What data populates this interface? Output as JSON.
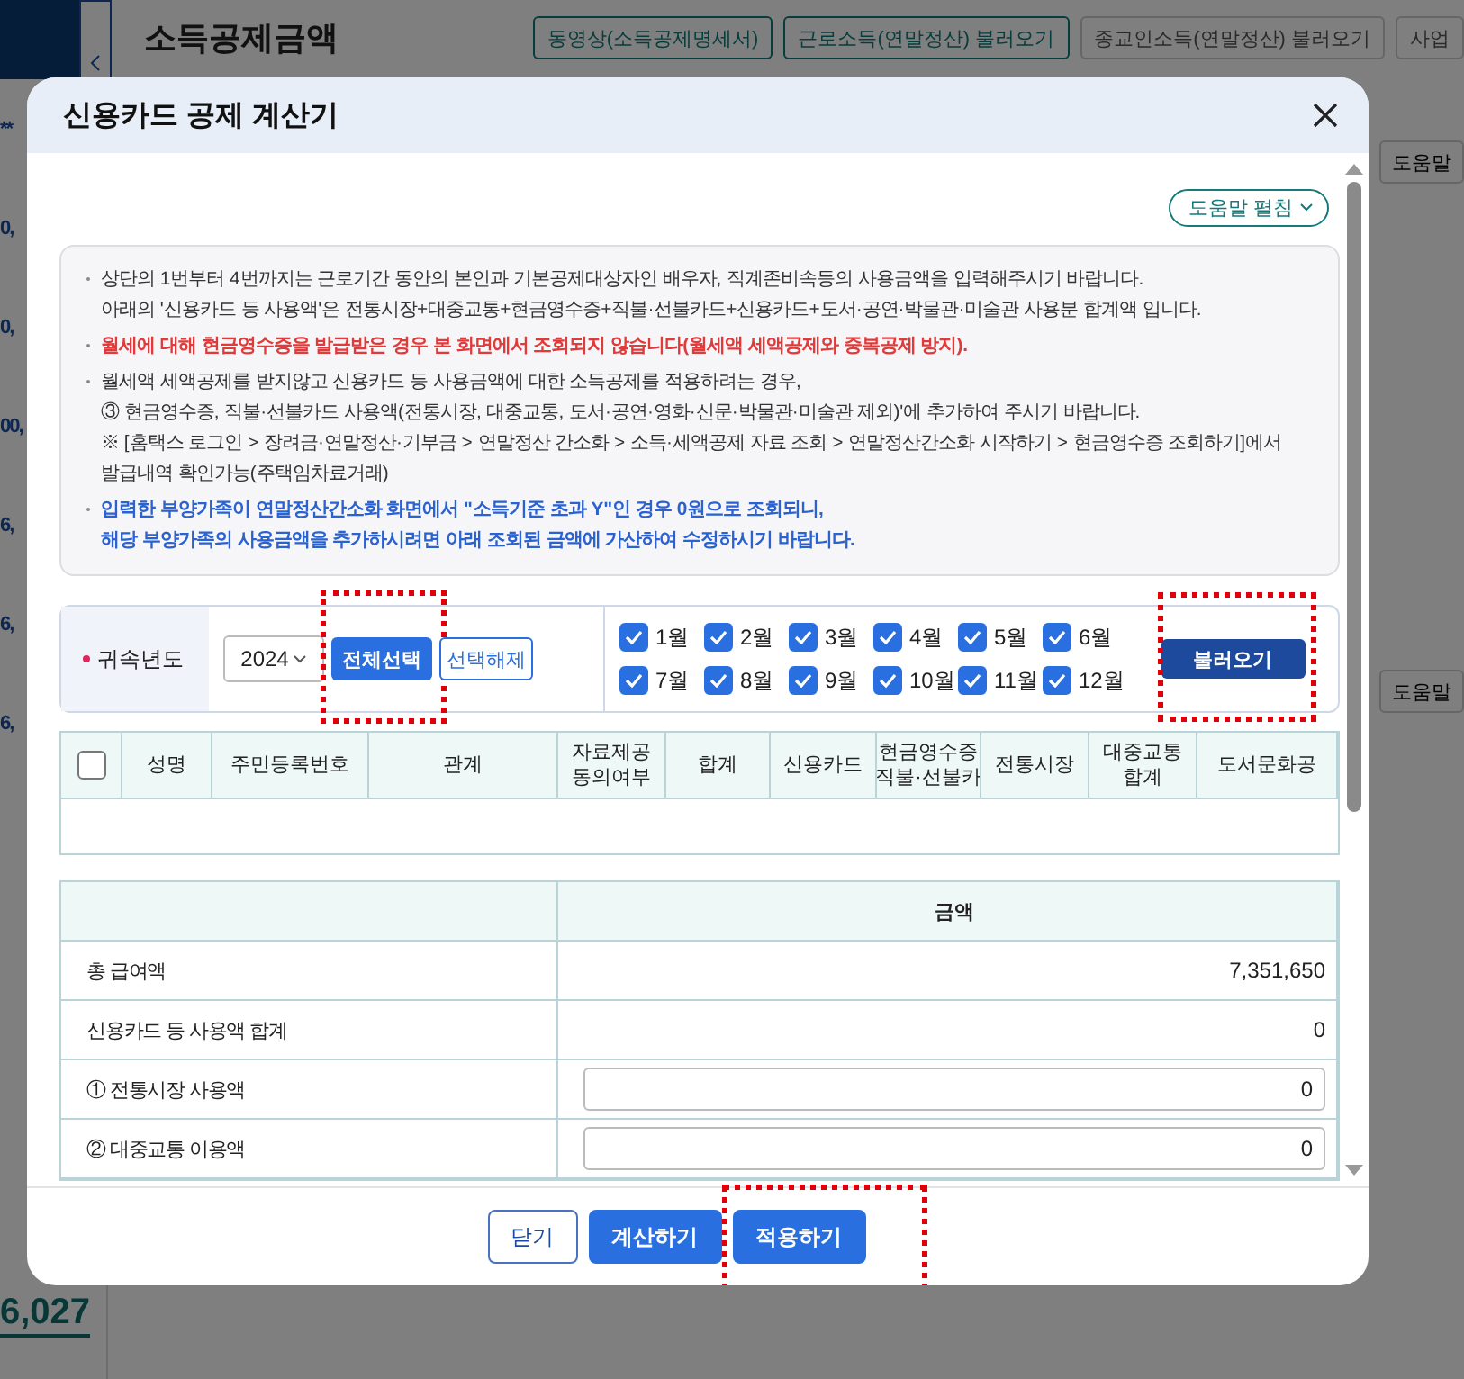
{
  "background": {
    "title": "소득공제금액",
    "buttons": [
      {
        "label": "동영상(소득공제명세서)",
        "kind": "outline"
      },
      {
        "label": "근로소득(연말정산) 불러오기",
        "kind": "outline"
      },
      {
        "label": "종교인소득(연말정산) 불러오기",
        "kind": "plain"
      },
      {
        "label": "사업",
        "kind": "plain"
      }
    ],
    "side_texts": [
      "**",
      "0,",
      "0,",
      "00,",
      "6,",
      "6,",
      "6,"
    ],
    "side_total": "6,027",
    "help_buttons": [
      "도움말",
      "도움말"
    ]
  },
  "modal": {
    "title": "신용카드 공제 계산기",
    "help_toggle": "도움말 펼침",
    "notices": [
      {
        "kind": "default",
        "lines": [
          "상단의 1번부터 4번까지는 근로기간 동안의 본인과 기본공제대상자인 배우자, 직계존비속등의 사용금액을 입력해주시기 바랍니다.",
          "아래의 '신용카드 등 사용액'은 전통시장+대중교통+현금영수증+직불·선불카드+신용카드+도서·공연·박물관·미술관 사용분 합계액 입니다."
        ]
      },
      {
        "kind": "alert",
        "lines": [
          "월세에 대해 현금영수증을 발급받은 경우 본 화면에서 조회되지 않습니다(월세액 세액공제와 중복공제 방지)."
        ]
      },
      {
        "kind": "default",
        "lines": [
          "월세액 세액공제를 받지않고 신용카드 등 사용금액에 대한 소득공제를 적용하려는 경우,",
          "③ 현금영수증, 직불·선불카드 사용액(전통시장, 대중교통, 도서·공연·영화·신문·박물관·미술관 제외)'에 추가하여 주시기 바랍니다.",
          "※ [홈택스 로그인 > 장려금·연말정산·기부금 > 연말정산 간소화 > 소득·세액공제 자료 조회 > 연말정산간소화 시작하기 > 현금영수증 조회하기]에서",
          "발급내역 확인가능(주택임차료거래)"
        ]
      },
      {
        "kind": "info",
        "lines": [
          "입력한 부양가족이 연말정산간소화 화면에서 \"소득기준 초과 Y\"인 경우 0원으로 조회되니,",
          "해당 부양가족의 사용금액을 추가하시려면 아래 조회된 금액에 가산하여 수정하시기 바랍니다."
        ]
      }
    ],
    "year": {
      "label": "귀속년도",
      "value": "2024"
    },
    "select_all": {
      "label": "전체선택",
      "highlighted": true
    },
    "deselect_all": {
      "label": "선택해제",
      "highlighted": false
    },
    "months": [
      {
        "label": "1월",
        "checked": true
      },
      {
        "label": "2월",
        "checked": true
      },
      {
        "label": "3월",
        "checked": true
      },
      {
        "label": "4월",
        "checked": true
      },
      {
        "label": "5월",
        "checked": true
      },
      {
        "label": "6월",
        "checked": true
      },
      {
        "label": "7월",
        "checked": true
      },
      {
        "label": "8월",
        "checked": true
      },
      {
        "label": "9월",
        "checked": true
      },
      {
        "label": "10월",
        "checked": true
      },
      {
        "label": "11월",
        "checked": true
      },
      {
        "label": "12월",
        "checked": true
      }
    ],
    "load": {
      "label": "불러오기",
      "highlighted": true
    },
    "family_table": {
      "select_all_checked": false,
      "columns": [
        [
          "성명"
        ],
        [
          "주민등록번호"
        ],
        [
          "관계"
        ],
        [
          "자료제공",
          "동의여부"
        ],
        [
          "합계"
        ],
        [
          "신용카드"
        ],
        [
          "현금영수증",
          "직불·선불카"
        ],
        [
          "전통시장"
        ],
        [
          "대중교통",
          "합계"
        ],
        [
          "도서문화공"
        ]
      ]
    },
    "amount_table": {
      "header": "금액",
      "rows": [
        {
          "label": "총 급여액",
          "kind": "text",
          "value": "7,351,650"
        },
        {
          "label": "신용카드 등 사용액 합계",
          "kind": "text",
          "value": "0"
        },
        {
          "label": "① 전통시장 사용액",
          "kind": "input",
          "value": "0"
        },
        {
          "label": "② 대중교통 이용액",
          "kind": "input",
          "value": "0"
        }
      ]
    },
    "footer": [
      {
        "label": "닫기",
        "kind": "outline",
        "highlighted": false
      },
      {
        "label": "계산하기",
        "kind": "primary",
        "highlighted": false
      },
      {
        "label": "적용하기",
        "kind": "primary",
        "highlighted": true
      }
    ]
  }
}
